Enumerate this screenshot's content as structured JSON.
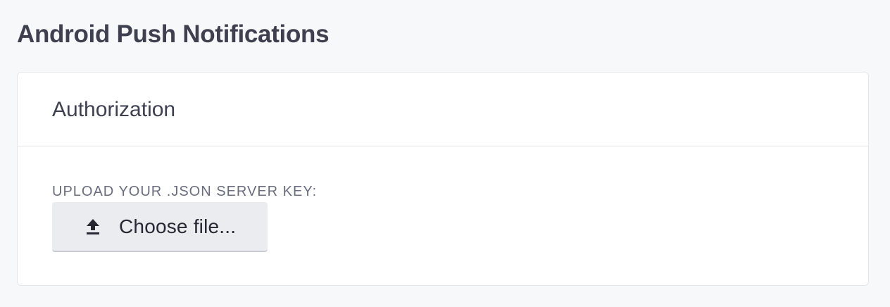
{
  "page": {
    "title": "Android Push Notifications"
  },
  "card": {
    "title": "Authorization",
    "field_label": "UPLOAD YOUR .JSON SERVER KEY:",
    "upload_button": {
      "label": "Choose file...",
      "icon": "upload-icon"
    }
  },
  "colors": {
    "background": "#f7f8f9",
    "card_background": "#ffffff",
    "border": "#e4e6ea",
    "title_text": "#3e3f4f",
    "label_text": "#6b6c7e",
    "button_background": "#ebecf0",
    "button_text": "#272833"
  }
}
